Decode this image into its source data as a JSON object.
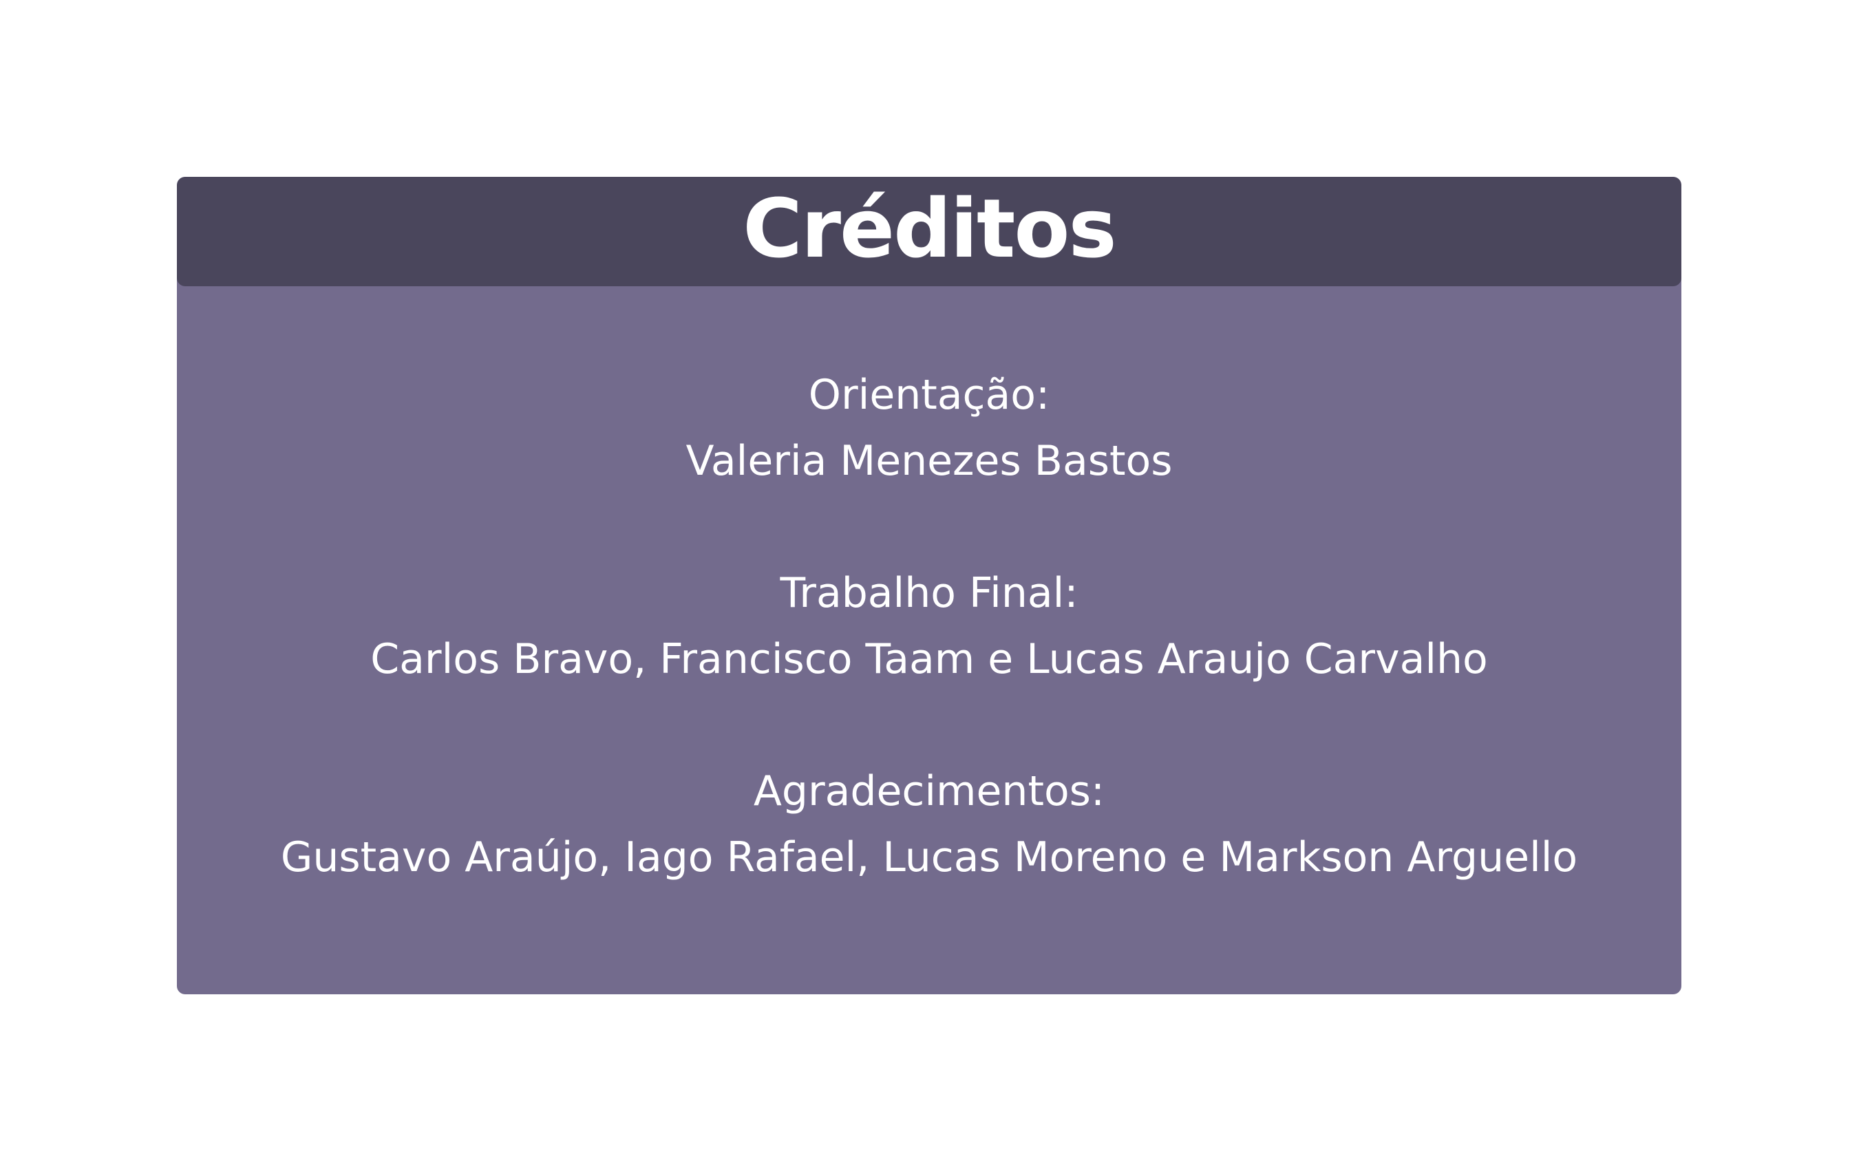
{
  "colors": {
    "background": "#ffffff",
    "panel": "#736b8d",
    "header": "#4a465c",
    "text": "#ffffff"
  },
  "credits": {
    "title": "Créditos",
    "sections": [
      {
        "heading": "Orientação:",
        "names": "Valeria Menezes Bastos"
      },
      {
        "heading": "Trabalho Final:",
        "names": "Carlos Bravo, Francisco Taam e Lucas Araujo Carvalho"
      },
      {
        "heading": "Agradecimentos:",
        "names": "Gustavo Araújo, Iago Rafael, Lucas Moreno e Markson Arguello"
      }
    ]
  }
}
